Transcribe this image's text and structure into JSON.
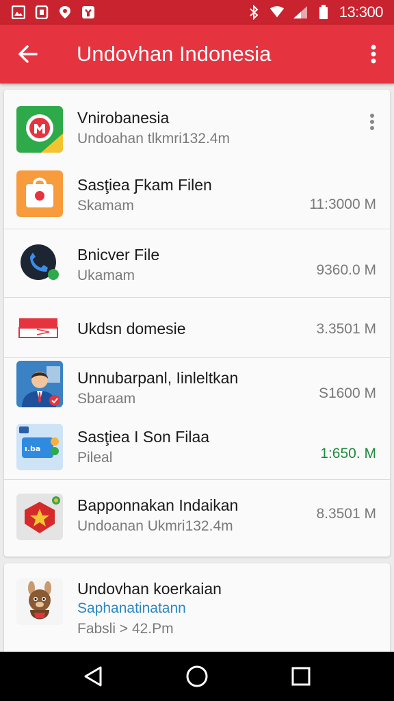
{
  "status_bar": {
    "time": "13:300",
    "left_icons": [
      "image-icon",
      "sim-icon",
      "location-icon",
      "bag-icon"
    ],
    "right_icons": [
      "bluetooth-icon",
      "wifi-icon",
      "signal-icon",
      "battery-icon"
    ]
  },
  "app_bar": {
    "title": "Undovhan Indonesia",
    "back_icon": "back-arrow-icon",
    "more_icon": "more-vert-icon"
  },
  "colors": {
    "status_bar": "#c8232f",
    "app_bar": "#e53340",
    "accent_green": "#1e8a3c",
    "accent_blue": "#2a87c6"
  },
  "list": [
    {
      "icon": "store-icon",
      "title": "Vnirobanesia",
      "subtitle": "Undoahan tlkmri132.4m",
      "size": ""
    },
    {
      "icon": "bag-icon",
      "title": "Sasţiea Ƒkam Filen",
      "subtitle": "Skamam",
      "size": "11:3000 M"
    },
    {
      "icon": "phone-icon",
      "title": "Bnicver File",
      "subtitle": "Ukamam",
      "size": "9360.0 M"
    },
    {
      "icon": "flag-icon",
      "title": "Ukdsn domesie",
      "subtitle": "",
      "size": "3.3501 M"
    },
    {
      "icon": "person-icon",
      "title": "Unnubarpanl, Iinleltkan",
      "subtitle": "Sbaraam",
      "size": "S1600 M"
    },
    {
      "icon": "chat-icon",
      "title": "Sasţiea I Son Filaa",
      "subtitle": "Pileal",
      "size": "1:650. M"
    },
    {
      "icon": "emblem-icon",
      "title": "Bapponnakan Indaikan",
      "subtitle": "Undoanan Ukmri132.4m",
      "size": "8.3501 M"
    }
  ],
  "card2": {
    "icon": "mascot-icon",
    "title": "Undovhan koerkaian",
    "subtitle": "Saphanatinatann",
    "meta": "Fabsli > 42.Pm"
  },
  "nav_bar": {
    "back_icon": "nav-back-icon",
    "home_icon": "nav-home-icon",
    "recents_icon": "nav-recents-icon"
  }
}
